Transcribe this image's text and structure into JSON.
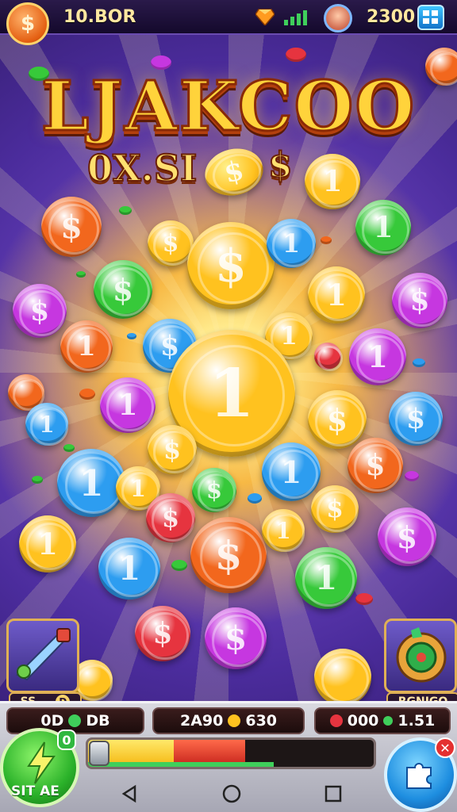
{
  "top_bar": {
    "coin_balance": "10.BOR",
    "gem_balance": "2300"
  },
  "title": {
    "main": "LJAKCOO",
    "sub": "0X.SI"
  },
  "side_cards": {
    "left_value": "SS",
    "left_badge": "D",
    "right_label": "RGNIGO"
  },
  "hud": {
    "stat_left": "0D",
    "stat_left_suffix": "DB",
    "stat_middle": "2A90",
    "stat_middle_suffix": "630",
    "stat_right": "000",
    "stat_right_suffix": "1.51",
    "spin_label": "SIT AE",
    "spin_badge": "0",
    "progress": {
      "yellow_fraction": 0.3,
      "red_fraction": 0.55
    }
  },
  "colors": {
    "coin_gold": "#ffc21f",
    "coin_green": "#37c93a",
    "coin_blue": "#2d9df0",
    "coin_purple": "#c637e0",
    "coin_orange": "#f2671d",
    "coin_red": "#e6343f"
  },
  "icons": [
    "dollar-icon",
    "gem-icon",
    "signal-icon",
    "grid-menu-icon",
    "back-icon",
    "home-icon",
    "recents-icon",
    "close-icon",
    "puzzle-icon"
  ]
}
